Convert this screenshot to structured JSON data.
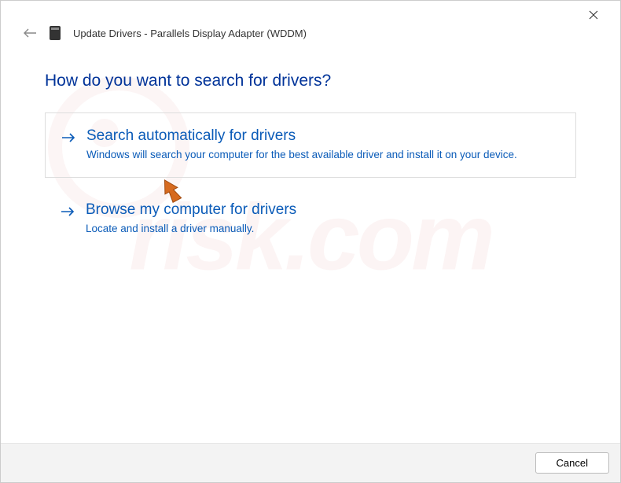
{
  "header": {
    "title": "Update Drivers - Parallels Display Adapter (WDDM)"
  },
  "main": {
    "question": "How do you want to search for drivers?",
    "options": [
      {
        "title": "Search automatically for drivers",
        "description": "Windows will search your computer for the best available driver and install it on your device."
      },
      {
        "title": "Browse my computer for drivers",
        "description": "Locate and install a driver manually."
      }
    ]
  },
  "footer": {
    "cancel_label": "Cancel"
  },
  "watermark": {
    "text": "risk.com"
  }
}
